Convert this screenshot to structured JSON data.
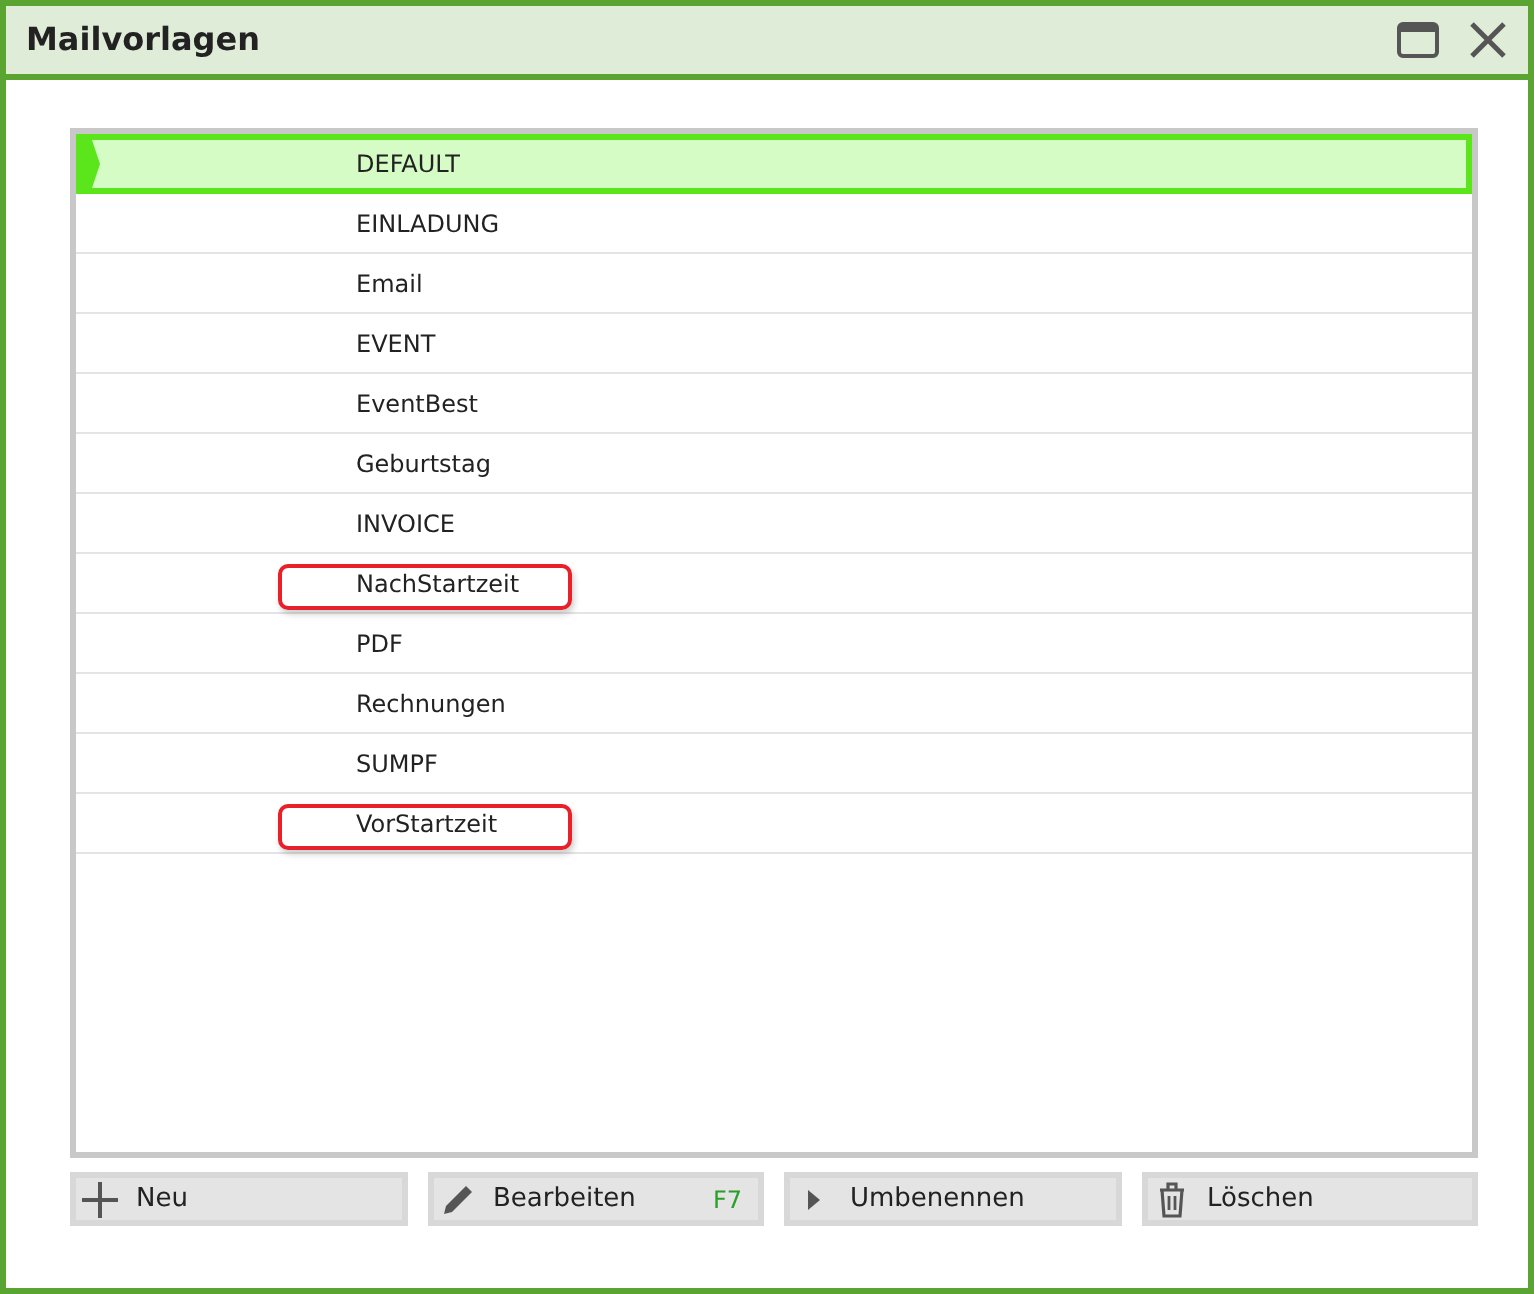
{
  "window": {
    "title": "Mailvorlagen"
  },
  "templates": [
    {
      "label": "DEFAULT",
      "selected": true,
      "highlighted": false
    },
    {
      "label": "EINLADUNG",
      "selected": false,
      "highlighted": false
    },
    {
      "label": "Email",
      "selected": false,
      "highlighted": false
    },
    {
      "label": "EVENT",
      "selected": false,
      "highlighted": false
    },
    {
      "label": "EventBest",
      "selected": false,
      "highlighted": false
    },
    {
      "label": "Geburtstag",
      "selected": false,
      "highlighted": false
    },
    {
      "label": "INVOICE",
      "selected": false,
      "highlighted": false
    },
    {
      "label": "NachStartzeit",
      "selected": false,
      "highlighted": true
    },
    {
      "label": "PDF",
      "selected": false,
      "highlighted": false
    },
    {
      "label": "Rechnungen",
      "selected": false,
      "highlighted": false
    },
    {
      "label": "SUMPF",
      "selected": false,
      "highlighted": false
    },
    {
      "label": "VorStartzeit",
      "selected": false,
      "highlighted": true
    }
  ],
  "buttons": [
    {
      "label": "Neu",
      "kind": "add"
    },
    {
      "label": "Bearbeiten",
      "kind": "edit",
      "shortcut": "F7"
    },
    {
      "label": "Umbenennen",
      "kind": "rename"
    },
    {
      "label": "Löschen",
      "kind": "delete"
    }
  ]
}
